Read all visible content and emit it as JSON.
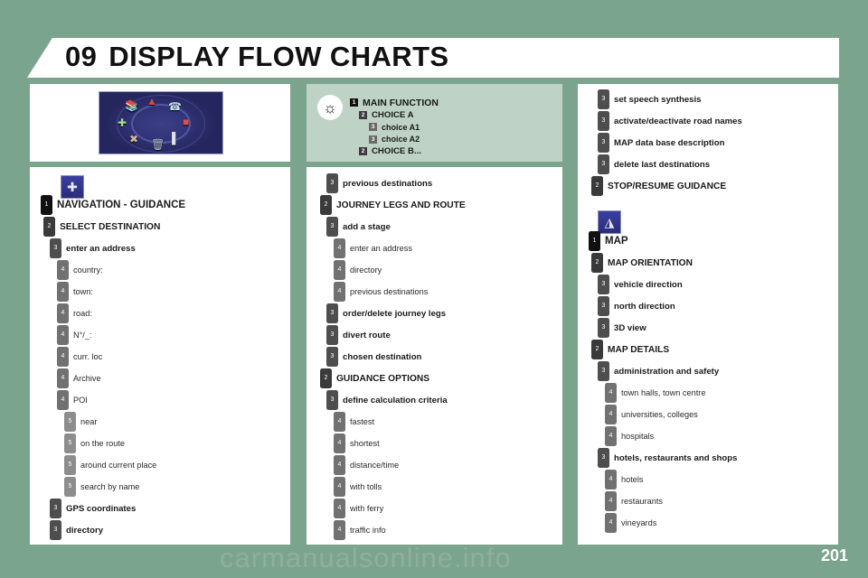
{
  "header": {
    "chapter_number": "09",
    "title": "DISPLAY FLOW CHARTS"
  },
  "illustration": {
    "alt": "carousel-menu-screen",
    "icons": [
      "books-icon",
      "warning-triangle-icon",
      "telephone-icon",
      "radio-icon",
      "flags-icon",
      "trash-icon",
      "tools-icon",
      "navigation-icon"
    ]
  },
  "legend": {
    "bulb_icon": "lightbulb-icon",
    "rows": [
      {
        "level": "1",
        "text": "MAIN FUNCTION"
      },
      {
        "level": "2",
        "text": "CHOICE A"
      },
      {
        "level": "3",
        "text": "choice A1"
      },
      {
        "level": "3",
        "text": "choice A2"
      },
      {
        "level": "2",
        "text": "CHOICE B..."
      }
    ]
  },
  "columns": {
    "left": {
      "section_icon": "navigation-crossroads-icon",
      "rows": [
        {
          "level": "1",
          "text": "NAVIGATION - GUIDANCE"
        },
        {
          "level": "2",
          "text": "SELECT DESTINATION"
        },
        {
          "level": "3",
          "text": "enter an address"
        },
        {
          "level": "4",
          "text": "country:"
        },
        {
          "level": "4",
          "text": "town:"
        },
        {
          "level": "4",
          "text": "road:"
        },
        {
          "level": "4",
          "text": "N°/_:"
        },
        {
          "level": "4",
          "text": "curr. loc"
        },
        {
          "level": "4",
          "text": "Archive"
        },
        {
          "level": "4",
          "text": "POI"
        },
        {
          "level": "5",
          "text": "near"
        },
        {
          "level": "5",
          "text": "on the route"
        },
        {
          "level": "5",
          "text": "around current place"
        },
        {
          "level": "5",
          "text": "search by name"
        },
        {
          "level": "3",
          "text": "GPS coordinates"
        },
        {
          "level": "3",
          "text": "directory"
        }
      ]
    },
    "middle": {
      "rows": [
        {
          "level": "3",
          "text": "previous destinations"
        },
        {
          "level": "2",
          "text": "JOURNEY LEGS AND ROUTE"
        },
        {
          "level": "3",
          "text": "add a stage"
        },
        {
          "level": "4",
          "text": "enter an address"
        },
        {
          "level": "4",
          "text": "directory"
        },
        {
          "level": "4",
          "text": "previous destinations"
        },
        {
          "level": "3",
          "text": "order/delete journey legs"
        },
        {
          "level": "3",
          "text": "divert route"
        },
        {
          "level": "3",
          "text": "chosen destination"
        },
        {
          "level": "2",
          "text": "GUIDANCE OPTIONS"
        },
        {
          "level": "3",
          "text": "define calculation criteria"
        },
        {
          "level": "4",
          "text": "fastest"
        },
        {
          "level": "4",
          "text": "shortest"
        },
        {
          "level": "4",
          "text": "distance/time"
        },
        {
          "level": "4",
          "text": "with tolls"
        },
        {
          "level": "4",
          "text": "with ferry"
        },
        {
          "level": "4",
          "text": "traffic info"
        }
      ]
    },
    "right": {
      "section_icon": "map-icon",
      "rows_top": [
        {
          "level": "3",
          "text": "set speech synthesis"
        },
        {
          "level": "3",
          "text": "activate/deactivate road names"
        },
        {
          "level": "3",
          "text": "MAP data base description"
        },
        {
          "level": "3",
          "text": "delete last destinations"
        },
        {
          "level": "2",
          "text": "STOP/RESUME GUIDANCE"
        }
      ],
      "rows_bottom": [
        {
          "level": "1",
          "text": "MAP"
        },
        {
          "level": "2",
          "text": "MAP ORIENTATION"
        },
        {
          "level": "3",
          "text": "vehicle direction"
        },
        {
          "level": "3",
          "text": "north direction"
        },
        {
          "level": "3",
          "text": "3D view"
        },
        {
          "level": "2",
          "text": "MAP DETAILS"
        },
        {
          "level": "3",
          "text": "administration and safety"
        },
        {
          "level": "4",
          "text": "town halls, town centre"
        },
        {
          "level": "4",
          "text": "universities, colleges"
        },
        {
          "level": "4",
          "text": "hospitals"
        },
        {
          "level": "3",
          "text": "hotels, restaurants and shops"
        },
        {
          "level": "4",
          "text": "hotels"
        },
        {
          "level": "4",
          "text": "restaurants"
        },
        {
          "level": "4",
          "text": "vineyards"
        }
      ]
    }
  },
  "footer": {
    "watermark": "carmanualsonline.info",
    "page_number": "201"
  },
  "colors": {
    "page_background": "#7ba48e",
    "panel_background": "#ffffff",
    "legend_background": "#bed3c5",
    "level1_badge": "#111111",
    "level2_badge": "#3a3a3a",
    "level3_badge": "#4e4e4e",
    "level4_badge": "#717171",
    "level5_badge": "#8d8d8d"
  }
}
